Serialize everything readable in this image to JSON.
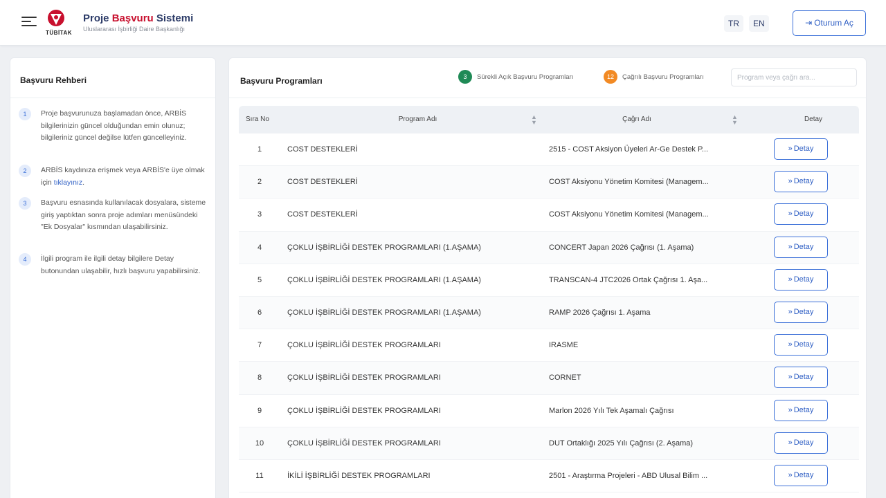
{
  "header": {
    "logo_text": "TÜBİTAK",
    "title_part1": "Proje ",
    "title_part2": "Başvuru",
    "title_part3": " Sistemi",
    "subtitle": "Uluslararası İşbirliği Daire Başkanlığı",
    "lang_tr": "TR",
    "lang_en": "EN",
    "login_label": "Oturum Aç",
    "login_icon": "sign-in-icon"
  },
  "guide": {
    "title": "Başvuru Rehberi",
    "items": [
      {
        "num": "1",
        "text": "Proje başvurunuza başlamadan önce, ARBİS bilgilerinizin güncel olduğundan emin olunuz; bilgileriniz güncel değilse lütfen güncelleyiniz."
      },
      {
        "num": "2",
        "text_before": "ARBİS kaydınıza erişmek veya ARBİS'e üye olmak için ",
        "link": "tıklayınız",
        "text_after": "."
      },
      {
        "num": "3",
        "text": "Başvuru esnasında kullanılacak dosyalara, sisteme giriş yaptıktan sonra proje adımları menüsündeki \"Ek Dosyalar\" kısmından ulaşabilirsiniz."
      },
      {
        "num": "4",
        "text": "İlgili program ile ilgili detay bilgilere Detay butonundan ulaşabilir, hızlı başvuru yapabilirsiniz."
      }
    ]
  },
  "main": {
    "title": "Başvuru Programları",
    "legend": {
      "green_count": "3",
      "green_label": "Sürekli Açık Başvuru Programları",
      "orange_count": "12",
      "orange_label": "Çağrılı Başvuru Programları",
      "green_color": "#1f8a56",
      "orange_color": "#f28a24"
    },
    "search_placeholder": "Program veya çağrı ara...",
    "columns": {
      "sira": "Sıra No",
      "program": "Program Adı",
      "cagri": "Çağrı Adı",
      "detay": "Detay"
    },
    "detay_label": "Detay",
    "rows": [
      {
        "sira": "1",
        "program": "COST DESTEKLERİ",
        "cagri": "2515 - COST Aksiyon Üyeleri Ar-Ge Destek P..."
      },
      {
        "sira": "2",
        "program": "COST DESTEKLERİ",
        "cagri": "COST Aksiyonu Yönetim Komitesi (Managem..."
      },
      {
        "sira": "3",
        "program": "COST DESTEKLERİ",
        "cagri": "COST Aksiyonu Yönetim Komitesi (Managem..."
      },
      {
        "sira": "4",
        "program": "ÇOKLU İŞBİRLİĞİ DESTEK PROGRAMLARI (1.AŞAMA)",
        "cagri": "CONCERT Japan 2026 Çağrısı (1. Aşama)"
      },
      {
        "sira": "5",
        "program": "ÇOKLU İŞBİRLİĞİ DESTEK PROGRAMLARI (1.AŞAMA)",
        "cagri": "TRANSCAN-4 JTC2026 Ortak Çağrısı 1. Aşa..."
      },
      {
        "sira": "6",
        "program": "ÇOKLU İŞBİRLİĞİ DESTEK PROGRAMLARI (1.AŞAMA)",
        "cagri": "RAMP 2026 Çağrısı 1. Aşama"
      },
      {
        "sira": "7",
        "program": "ÇOKLU İŞBİRLİĞİ DESTEK PROGRAMLARI",
        "cagri": "IRASME"
      },
      {
        "sira": "8",
        "program": "ÇOKLU İŞBİRLİĞİ DESTEK PROGRAMLARI",
        "cagri": "CORNET"
      },
      {
        "sira": "9",
        "program": "ÇOKLU İŞBİRLİĞİ DESTEK PROGRAMLARI",
        "cagri": "Marlon 2026 Yılı Tek Aşamalı Çağrısı"
      },
      {
        "sira": "10",
        "program": "ÇOKLU İŞBİRLİĞİ DESTEK PROGRAMLARI",
        "cagri": "DUT Ortaklığı 2025 Yılı Çağrısı (2. Aşama)"
      },
      {
        "sira": "11",
        "program": "İKİLİ İŞBİRLİĞİ DESTEK PROGRAMLARI",
        "cagri": "2501 - Araştırma Projeleri - ABD Ulusal Bilim ..."
      }
    ]
  }
}
